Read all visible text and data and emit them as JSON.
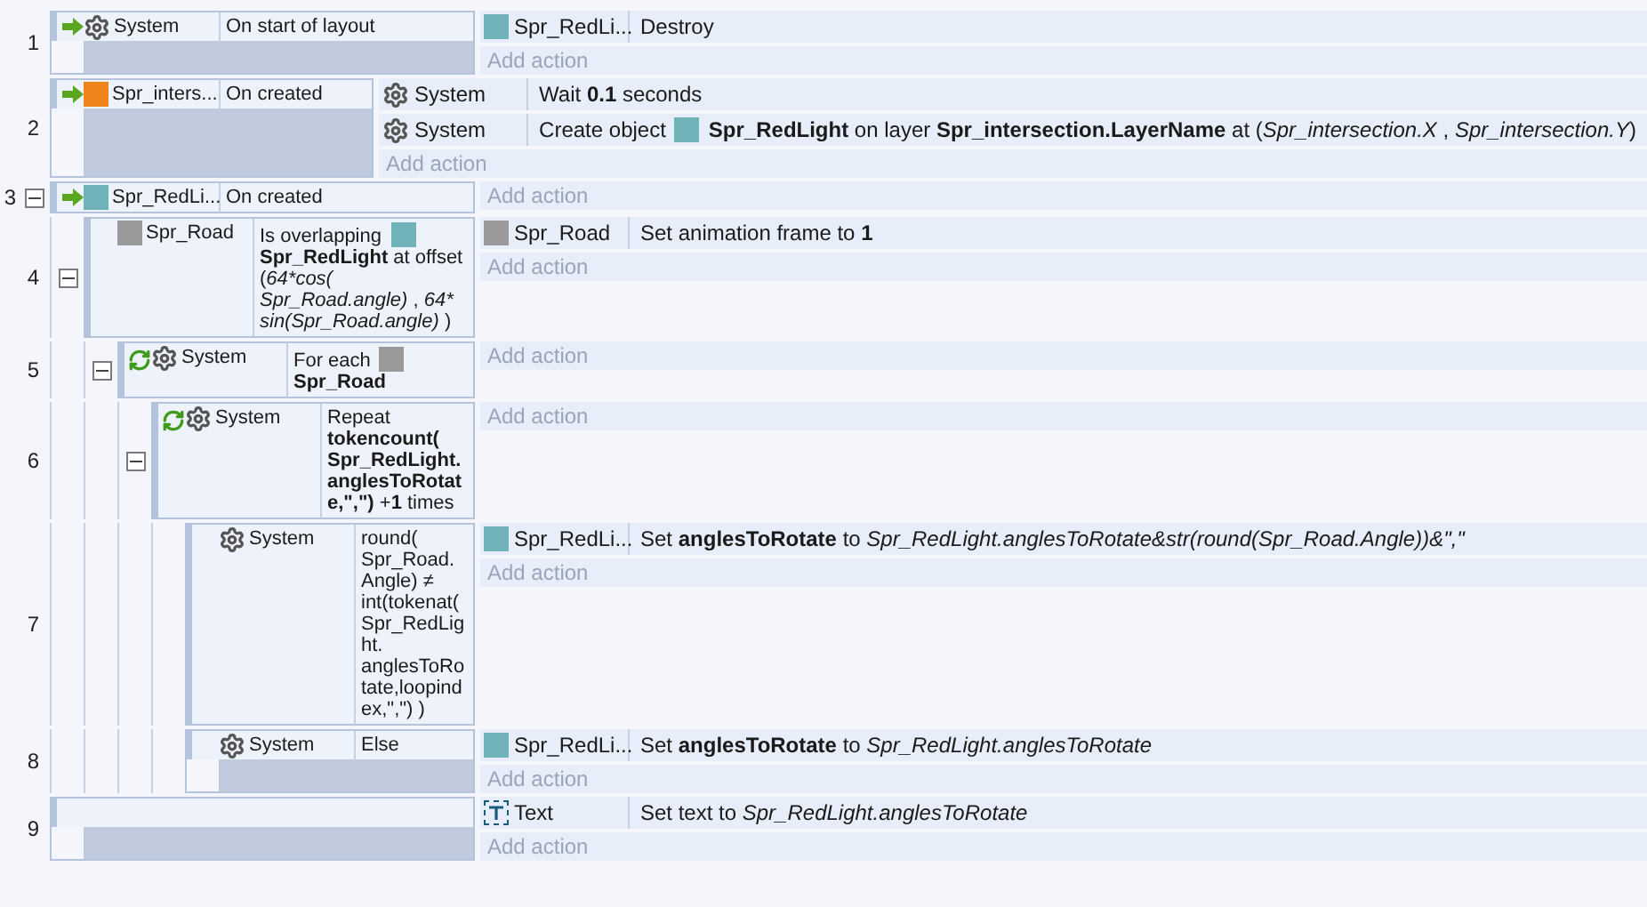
{
  "events": [
    {
      "number": "1",
      "conditions": [
        {
          "kind": "trigger",
          "object": {
            "kind": "system",
            "name": "System"
          },
          "parts": [
            {
              "kind": "text",
              "text": "On start of layout"
            }
          ]
        }
      ],
      "actions": [
        {
          "object": {
            "kind": "sprite",
            "color": "#6fb2b8",
            "name": "Spr_RedLi..."
          },
          "parts": [
            {
              "kind": "text",
              "text": "Destroy"
            }
          ]
        }
      ],
      "add_action": "Add action"
    },
    {
      "number": "2",
      "conditions": [
        {
          "kind": "trigger",
          "object": {
            "kind": "sprite",
            "color": "#f0841c",
            "name": "Spr_inters..."
          },
          "parts": [
            {
              "kind": "text",
              "text": "On created"
            }
          ]
        }
      ],
      "actions": [
        {
          "object": {
            "kind": "system",
            "name": "System"
          },
          "parts": [
            {
              "kind": "text",
              "text": "Wait "
            },
            {
              "kind": "bold",
              "text": "0.1"
            },
            {
              "kind": "text",
              "text": " seconds"
            }
          ]
        },
        {
          "object": {
            "kind": "system",
            "name": "System"
          },
          "parts": [
            {
              "kind": "text",
              "text": "Create object"
            },
            {
              "kind": "icon",
              "color": "#6fb2b8"
            },
            {
              "kind": "bold",
              "text": "Spr_RedLight"
            },
            {
              "kind": "text",
              "text": " on layer "
            },
            {
              "kind": "bold",
              "text": "Spr_intersection.LayerName"
            },
            {
              "kind": "text",
              "text": " at ("
            },
            {
              "kind": "italic",
              "text": "Spr_intersection.X"
            },
            {
              "kind": "text",
              "text": " , "
            },
            {
              "kind": "italic",
              "text": "Spr_intersection.Y"
            },
            {
              "kind": "text",
              "text": ")"
            }
          ]
        }
      ],
      "add_action": "Add action"
    },
    {
      "number": "3",
      "expanded": true,
      "conditions": [
        {
          "kind": "trigger",
          "object": {
            "kind": "sprite",
            "color": "#6fb2b8",
            "name": "Spr_RedLi..."
          },
          "parts": [
            {
              "kind": "text",
              "text": "On created"
            }
          ]
        }
      ],
      "add_action": "Add action",
      "children": [
        {
          "number": "4",
          "expanded": true,
          "conditions": [
            {
              "object": {
                "kind": "sprite",
                "color": "#9a9a9a",
                "name": "Spr_Road"
              },
              "parts": [
                {
                  "kind": "text",
                  "text": "Is overlapping"
                },
                {
                  "kind": "icon",
                  "color": "#6fb2b8"
                },
                {
                  "kind": "bold",
                  "text": "Spr_RedLight"
                },
                {
                  "kind": "text",
                  "text": " at offset ("
                },
                {
                  "kind": "italic",
                  "text": "64*cos( Spr_Road.angle)"
                },
                {
                  "kind": "text",
                  "text": " , "
                },
                {
                  "kind": "italic",
                  "text": "64* sin(Spr_Road.angle)"
                },
                {
                  "kind": "text",
                  "text": " )"
                }
              ]
            }
          ],
          "actions": [
            {
              "object": {
                "kind": "sprite",
                "color": "#9a9a9a",
                "name": "Spr_Road"
              },
              "parts": [
                {
                  "kind": "text",
                  "text": "Set animation frame to "
                },
                {
                  "kind": "bold",
                  "text": "1"
                }
              ]
            }
          ],
          "add_action": "Add action",
          "children": [
            {
              "number": "5",
              "expanded": true,
              "conditions": [
                {
                  "kind": "loop",
                  "object": {
                    "kind": "system",
                    "name": "System"
                  },
                  "parts": [
                    {
                      "kind": "text",
                      "text": "For each"
                    },
                    {
                      "kind": "icon",
                      "color": "#9a9a9a"
                    },
                    {
                      "kind": "bold",
                      "text": "Spr_Road"
                    }
                  ]
                }
              ],
              "add_action": "Add action",
              "children": [
                {
                  "number": "6",
                  "expanded": true,
                  "conditions": [
                    {
                      "kind": "loop",
                      "object": {
                        "kind": "system",
                        "name": "System"
                      },
                      "parts": [
                        {
                          "kind": "text",
                          "text": "Repeat "
                        },
                        {
                          "kind": "bold",
                          "text": "tokencount( Spr_RedLight. anglesToRotate,\",\")"
                        },
                        {
                          "kind": "text",
                          "text": " +"
                        },
                        {
                          "kind": "bold",
                          "text": "1"
                        },
                        {
                          "kind": "text",
                          "text": " times"
                        }
                      ]
                    }
                  ],
                  "add_action": "Add action",
                  "children": [
                    {
                      "number": "7",
                      "conditions": [
                        {
                          "object": {
                            "kind": "system",
                            "name": "System"
                          },
                          "parts": [
                            {
                              "kind": "text",
                              "text": "round( Spr_Road. Angle) ≠ int(tokenat( Spr_RedLight. anglesToRotate,loopindex,\",\") )"
                            }
                          ]
                        }
                      ],
                      "actions": [
                        {
                          "object": {
                            "kind": "sprite",
                            "color": "#6fb2b8",
                            "name": "Spr_RedLi..."
                          },
                          "parts": [
                            {
                              "kind": "text",
                              "text": "Set "
                            },
                            {
                              "kind": "bold",
                              "text": "anglesToRotate"
                            },
                            {
                              "kind": "text",
                              "text": " to "
                            },
                            {
                              "kind": "italic",
                              "text": "Spr_RedLight.anglesToRotate&str(round(Spr_Road.Angle))&\",\""
                            }
                          ]
                        }
                      ],
                      "add_action": "Add action"
                    },
                    {
                      "number": "8",
                      "conditions": [
                        {
                          "object": {
                            "kind": "system",
                            "name": "System"
                          },
                          "parts": [
                            {
                              "kind": "text",
                              "text": "Else"
                            }
                          ]
                        }
                      ],
                      "actions": [
                        {
                          "object": {
                            "kind": "sprite",
                            "color": "#6fb2b8",
                            "name": "Spr_RedLi..."
                          },
                          "parts": [
                            {
                              "kind": "text",
                              "text": "Set "
                            },
                            {
                              "kind": "bold",
                              "text": "anglesToRotate"
                            },
                            {
                              "kind": "text",
                              "text": " to "
                            },
                            {
                              "kind": "italic",
                              "text": "Spr_RedLight.anglesToRotate"
                            }
                          ]
                        }
                      ],
                      "add_action": "Add action"
                    }
                  ]
                }
              ]
            }
          ]
        }
      ]
    },
    {
      "number": "9",
      "actions": [
        {
          "object": {
            "kind": "text",
            "name": "Text"
          },
          "parts": [
            {
              "kind": "text",
              "text": "Set text to "
            },
            {
              "kind": "italic",
              "text": "Spr_RedLight.anglesToRotate"
            }
          ]
        }
      ],
      "add_action": "Add action"
    }
  ]
}
